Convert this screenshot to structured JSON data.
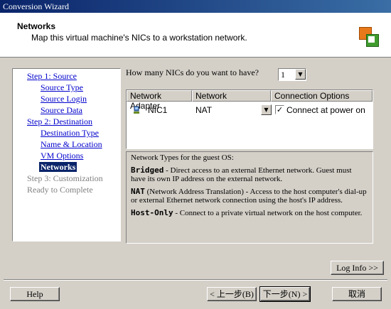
{
  "window": {
    "title": "Conversion Wizard"
  },
  "header": {
    "title": "Networks",
    "subtitle": "Map this virtual machine's NICs to a workstation network.",
    "logo_icon": "vmware-converter-logo"
  },
  "nav": {
    "items": [
      {
        "label": "Step 1: Source",
        "state": "link"
      },
      {
        "label": "Source Type",
        "state": "link"
      },
      {
        "label": "Source Login",
        "state": "link"
      },
      {
        "label": "Source Data",
        "state": "link"
      },
      {
        "label": "Step 2: Destination",
        "state": "link"
      },
      {
        "label": "Destination Type",
        "state": "link"
      },
      {
        "label": "Name & Location",
        "state": "link"
      },
      {
        "label": "VM Options",
        "state": "link"
      },
      {
        "label": "Networks",
        "state": "current"
      },
      {
        "label": "Step 3: Customization",
        "state": "disabled"
      },
      {
        "label": "Ready to Complete",
        "state": "disabled"
      }
    ]
  },
  "nic_count": {
    "question": "How many NICs do you want to have?",
    "value": "1"
  },
  "nic_table": {
    "columns": [
      "Network Adapter",
      "Network",
      "Connection Options"
    ],
    "rows": [
      {
        "adapter": "NIC1",
        "network": "NAT",
        "option": "Connect at power on",
        "checked": "✓"
      }
    ]
  },
  "info": {
    "heading": "Network Types for the guest OS:",
    "bridged_term": "Bridged",
    "bridged_desc": " - Direct access to an external Ethernet network. Guest must have its own IP address on the external network.",
    "nat_term": "NAT",
    "nat_desc": " (Network Address Translation) - Access to the host computer's dial-up or external Ethernet network connection using the host's IP address.",
    "hostonly_term": "Host-Only",
    "hostonly_desc": " - Connect to a private virtual network on the host computer."
  },
  "buttons": {
    "log_info": "Log Info >>",
    "help": "Help",
    "back": "< 上一步(B)",
    "next": "下一步(N) >",
    "cancel": "取消"
  },
  "colors": {
    "titlebar": "#0a246a",
    "link": "#0000cc",
    "selected_bg": "#0a246a",
    "face": "#d4d0c8"
  }
}
